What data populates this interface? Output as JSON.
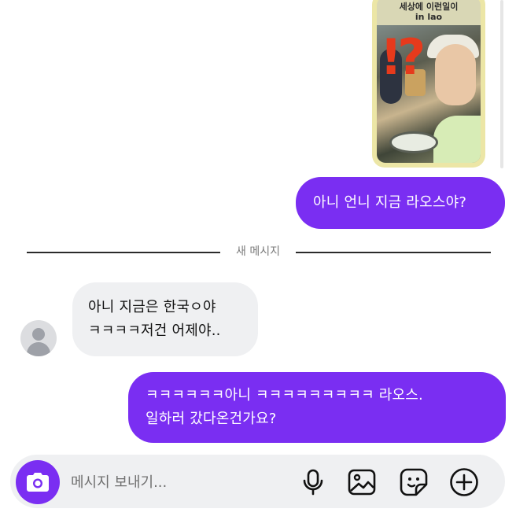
{
  "shared_story": {
    "caption_line1": "세상에 이런일이",
    "caption_line2": "in lao",
    "overlay_text": "!?"
  },
  "messages": [
    {
      "id": "out-1",
      "direction": "outgoing",
      "lines": [
        "아니 언니 지금 라오스야?"
      ]
    },
    {
      "id": "in-1",
      "direction": "incoming",
      "lines": [
        "아니 지금은 한국ㅇ야",
        "ㅋㅋㅋㅋ저건 어제야.."
      ]
    },
    {
      "id": "out-2",
      "direction": "outgoing",
      "lines": [
        "ㅋㅋㅋㅋㅋㅋ아니 ㅋㅋㅋㅋㅋㅋㅋㅋㅋ 라오스.",
        "일하러 갔다온건가요?"
      ]
    }
  ],
  "divider": {
    "label": "새 메시지"
  },
  "composer": {
    "placeholder": "메시지 보내기...",
    "value": ""
  },
  "icons": {
    "camera": "camera-icon",
    "mic": "microphone-icon",
    "gallery": "image-gallery-icon",
    "sticker": "sticker-icon",
    "plus": "plus-circle-icon",
    "avatar": "default-avatar-icon"
  },
  "colors": {
    "accent": "#7a2ef2",
    "incoming_bubble": "#eff0f2",
    "composer_bg": "#eff0f2",
    "divider_text": "#7a7a7a",
    "story_border": "#ece6a6",
    "overlay_red": "#e63a1c"
  }
}
